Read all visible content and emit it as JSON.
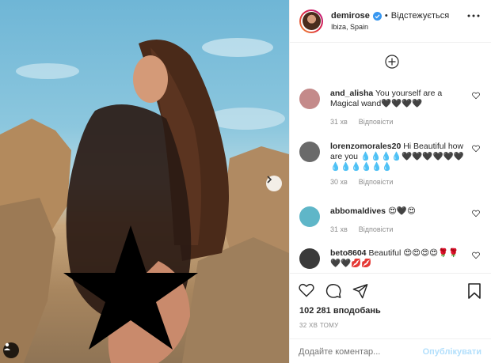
{
  "post": {
    "username": "demirose",
    "following_label": "Відстежується",
    "location": "Ibiza, Spain"
  },
  "comments": [
    {
      "user": "and_alisha",
      "text": "You yourself are a Magical wand🖤🖤🖤🖤",
      "time": "31 хв",
      "reply": "Відповісти",
      "avatar_color": "#c48a8a"
    },
    {
      "user": "lorenzomorales20",
      "text": "Hi Beautiful how are you 💧💧💧💧🖤🖤🖤🖤🖤🖤💧💧💧💧💧💧",
      "time": "30 хв",
      "reply": "Відповісти",
      "avatar_color": "#6a6a6a"
    },
    {
      "user": "abbomaldives",
      "text": "😍🖤😍",
      "time": "31 хв",
      "reply": "Відповісти",
      "avatar_color": "#5fb6c8"
    },
    {
      "user": "beto8604",
      "text": "Beautiful 😍😍😍😍🌹🌹🖤🖤💋💋",
      "time": "",
      "reply": "",
      "avatar_color": "#3a3a3a"
    }
  ],
  "likes_label": "102 281 вподобань",
  "time_label": "32 ХВ ТОМУ",
  "add_comment_placeholder": "Додайте коментар...",
  "publish_label": "Опублікувати",
  "colors": {
    "accent": "#0095f6",
    "publish_disabled": "#b2dffc",
    "verified": "#3897f0"
  }
}
